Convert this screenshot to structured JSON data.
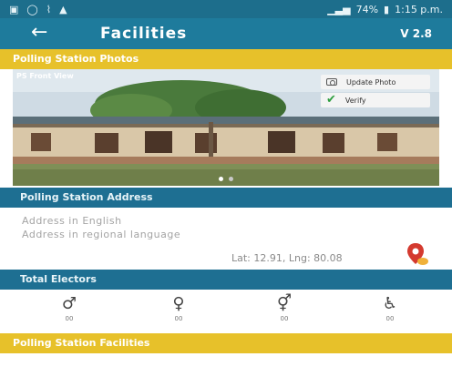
{
  "status_bar": {
    "left_icons": [
      "notification-icon",
      "whatsapp-icon",
      "hotspot-icon",
      "warning-icon"
    ],
    "battery": "74%",
    "time": "1:15 p.m."
  },
  "app_bar": {
    "title": "Facilities",
    "version": "V 2.8"
  },
  "photos_section": {
    "header": "Polling Station Photos",
    "photo_caption": "PS Front View",
    "update_photo_label": "Update Photo",
    "verify_label": "Verify"
  },
  "address_section": {
    "header": "Polling Station Address",
    "address_english": "Address in English",
    "address_regional": "Address in regional language",
    "coordinates": "Lat: 12.91, Lng: 80.08"
  },
  "electors_section": {
    "header": "Total Electors",
    "categories": [
      {
        "icon": "male-voter-icon",
        "count": "00"
      },
      {
        "icon": "female-voter-icon",
        "count": "00"
      },
      {
        "icon": "third-gender-voter-icon",
        "count": "00"
      },
      {
        "icon": "wheelchair-voter-icon",
        "count": "00"
      }
    ]
  },
  "facilities_section": {
    "header": "Polling Station Facilities"
  }
}
